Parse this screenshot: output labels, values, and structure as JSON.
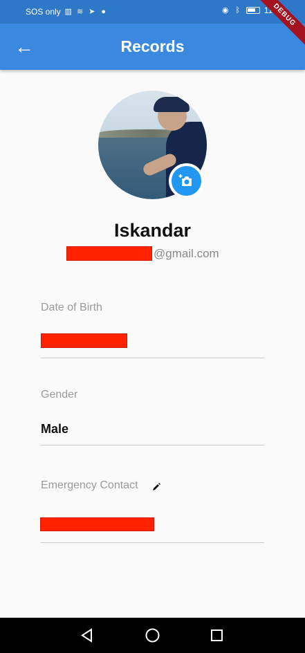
{
  "status_bar": {
    "carrier": "SOS only",
    "time": "11:30"
  },
  "app_bar": {
    "title": "Records",
    "back_icon": "arrow-left-icon",
    "debug_label": "DEBUG"
  },
  "profile": {
    "name": "Iskandar",
    "email_visible_suffix": "@gmail.com",
    "avatar_icon": "avatar-photo",
    "camera_icon": "add-photo-icon"
  },
  "fields": {
    "date_of_birth_label": "Date of Birth",
    "gender_label": "Gender",
    "gender_value": "Male",
    "emergency_contact_label": "Emergency Contact",
    "edit_icon": "pencil-icon"
  },
  "colors": {
    "status_bar": "#2f78c8",
    "app_bar": "#3a88e0",
    "camera_button": "#2196f3",
    "redaction": "#ff2200"
  },
  "navigation": {
    "back_icon": "triangle-back-icon",
    "home_icon": "circle-home-icon",
    "recent_icon": "square-recents-icon"
  }
}
